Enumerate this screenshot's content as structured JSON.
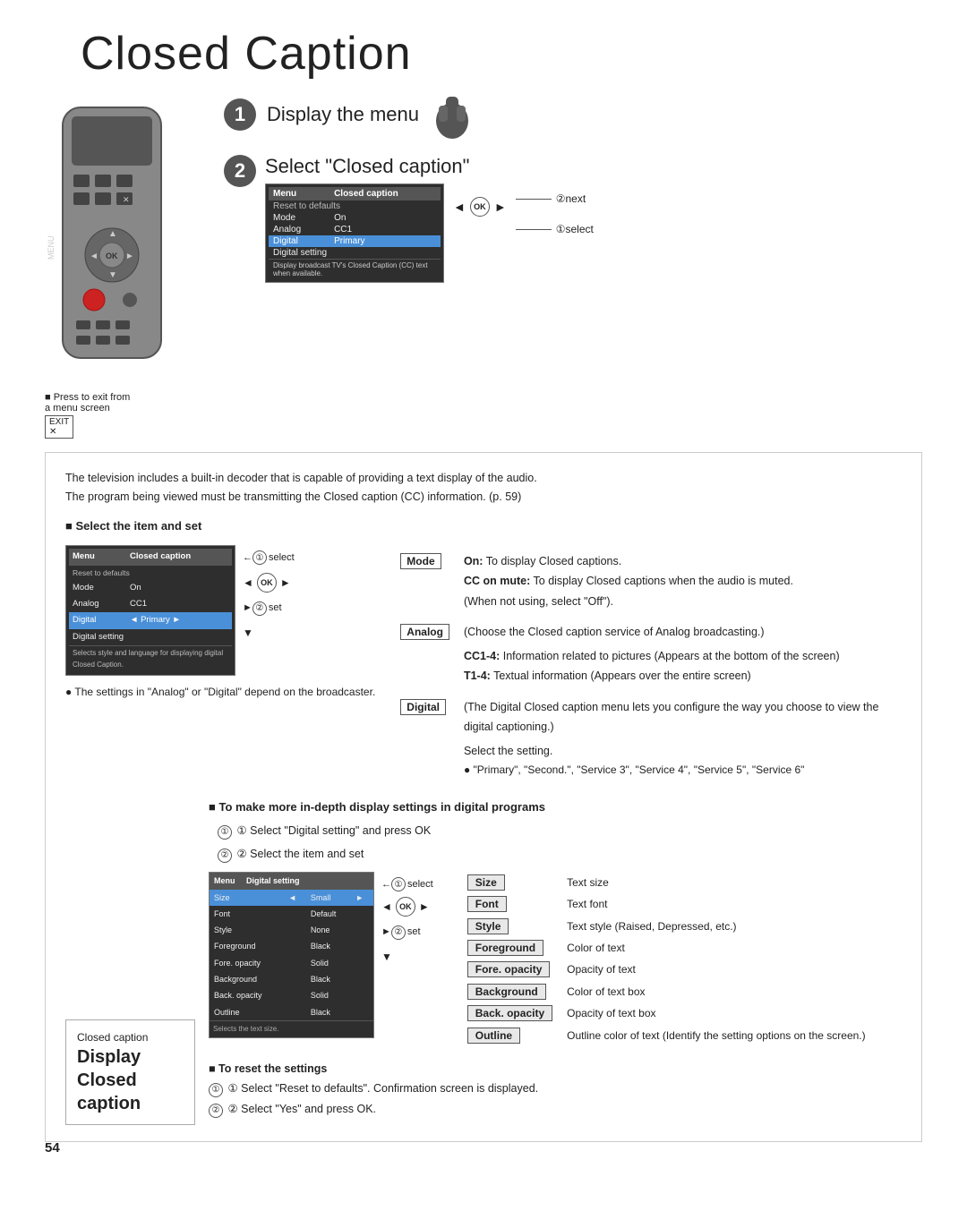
{
  "page": {
    "title": "Closed Caption",
    "page_number": "54"
  },
  "step1": {
    "label": "Display the menu"
  },
  "step2": {
    "label": "Select \"Closed caption\""
  },
  "press_exit": {
    "line1": "■ Press to exit from",
    "line2": "a menu screen",
    "exit_label": "EXIT"
  },
  "nav_annotations": {
    "next": "②next",
    "select": "①select"
  },
  "info_box": {
    "intro": "The television includes a built-in decoder that is capable of providing a text display of the audio.",
    "intro2": "The program being viewed must be transmitting the Closed caption (CC) information. (p. 59)",
    "select_header": "■ Select the item and set",
    "select1": "①select",
    "set1": "②set"
  },
  "mode_section": {
    "mode_label": "Mode",
    "mode_on": "On:",
    "mode_on_desc": "To display Closed captions.",
    "mode_cc_mute": "CC on mute:",
    "mode_cc_mute_desc": "To display Closed captions when the audio is muted.",
    "mode_off": "(When not using, select \"Off\").",
    "analog_label": "Analog",
    "analog_desc": "(Choose the Closed caption service of Analog broadcasting.)",
    "cc1_4_label": "CC1-4:",
    "cc1_4_desc": "Information related to pictures (Appears at the bottom of the screen)",
    "t1_4_label": "T1-4:",
    "t1_4_desc": "Textual information (Appears over the entire screen)",
    "digital_label": "Digital",
    "digital_desc": "(The Digital Closed caption menu lets you configure the way you choose to view the digital captioning.)",
    "select_setting": "Select the setting.",
    "service_note": "● \"Primary\", \"Second.\", \"Service 3\", \"Service 4\", \"Service 5\", \"Service 6\""
  },
  "analog_note": "● The settings in \"Analog\" or \"Digital\" depend on the broadcaster.",
  "digital_programs": {
    "header": "■ To make more in-depth display settings in digital programs",
    "step1": "① Select \"Digital setting\" and press OK",
    "step2": "② Select the item and set",
    "select": "①select",
    "set": "②set"
  },
  "settings_table": {
    "size_label": "Size",
    "size_desc": "Text size",
    "font_label": "Font",
    "font_desc": "Text font",
    "style_label": "Style",
    "style_desc": "Text style (Raised, Depressed, etc.)",
    "foreground_label": "Foreground",
    "foreground_desc": "Color of text",
    "fore_opacity_label": "Fore. opacity",
    "fore_opacity_desc": "Opacity of text",
    "background_label": "Background",
    "background_desc": "Color of text box",
    "back_opacity_label": "Back. opacity",
    "back_opacity_desc": "Opacity of text box",
    "outline_label": "Outline",
    "outline_desc": "Outline color of text (Identify the setting options on the screen.)"
  },
  "reset_section": {
    "header": "■ To reset the settings",
    "step1": "① Select \"Reset to defaults\". Confirmation screen is displayed.",
    "step2": "② Select \"Yes\" and press OK."
  },
  "sidebar": {
    "top": "Closed caption",
    "line1": "Display",
    "line2": "Closed",
    "line3": "caption"
  },
  "menu1": {
    "title": "Menu",
    "closed_caption": "Closed caption",
    "reset": "Reset to defaults",
    "mode_row": [
      "Mode",
      "On"
    ],
    "analog_row": [
      "Analog",
      "CC1"
    ],
    "digital_row": [
      "Digital",
      "Primary"
    ],
    "digital_setting": "Digital setting"
  },
  "digital_menu": {
    "title": "Menu",
    "digital_setting": "Digital setting",
    "size_row": [
      "Size",
      "◄",
      "Small",
      "►"
    ],
    "font_row": [
      "Font",
      "",
      "Default"
    ],
    "style_row": [
      "Style",
      "",
      "None"
    ],
    "foreground_row": [
      "Foreground",
      "",
      "Black"
    ],
    "fore_opacity_row": [
      "Fore. opacity",
      "",
      "Solid"
    ],
    "background_row": [
      "Background",
      "",
      "Black"
    ],
    "back_opacity_row": [
      "Back. opacity",
      "",
      "Solid"
    ],
    "outline_row": [
      "Outline",
      "",
      "Black"
    ],
    "note": "Selects the text size."
  }
}
